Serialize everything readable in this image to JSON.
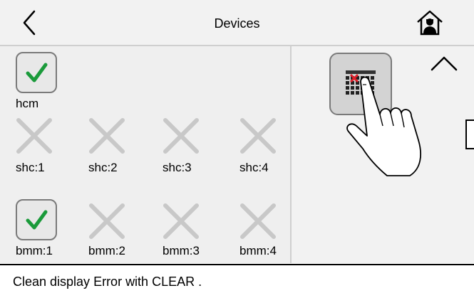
{
  "header": {
    "title": "Devices",
    "back_icon": "chevron-left-icon",
    "home_icon": "home-person-icon"
  },
  "devices": {
    "hcm": {
      "label": "hcm",
      "status": "ok"
    },
    "shc": [
      {
        "label": "shc:1",
        "status": "absent"
      },
      {
        "label": "shc:2",
        "status": "absent"
      },
      {
        "label": "shc:3",
        "status": "absent"
      },
      {
        "label": "shc:4",
        "status": "absent"
      }
    ],
    "bmm": [
      {
        "label": "bmm:1",
        "status": "ok"
      },
      {
        "label": "bmm:2",
        "status": "absent"
      },
      {
        "label": "bmm:3",
        "status": "absent"
      },
      {
        "label": "bmm:4",
        "status": "absent"
      }
    ]
  },
  "right_panel": {
    "clear_icon": "clear-errors-grid-icon",
    "up_icon": "chevron-up-icon",
    "hint_icon": "pointing-hand-icon"
  },
  "status": {
    "message": "Clean display Error with CLEAR ."
  },
  "colors": {
    "check": "#1a9a3a",
    "x_mark": "#c8c8c8",
    "error_x": "#e0202a"
  }
}
